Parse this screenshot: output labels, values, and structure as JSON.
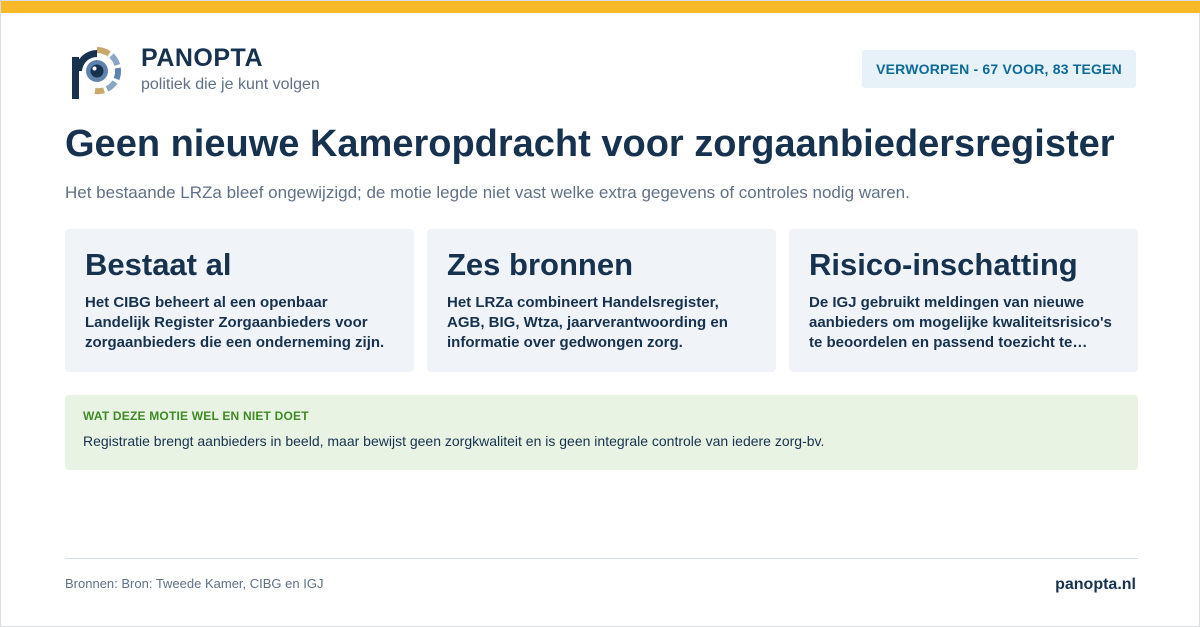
{
  "brand": {
    "name": "PANOPTA",
    "tagline": "politiek die je kunt volgen",
    "site": "panopta.nl"
  },
  "status_badge": "VERWORPEN - 67 VOOR, 83 TEGEN",
  "headline": "Geen nieuwe Kameropdracht voor zorgaanbiedersregister",
  "subheadline": "Het bestaande LRZa bleef ongewijzigd; de motie legde niet vast welke extra gegevens of controles nodig waren.",
  "cards": [
    {
      "title": "Bestaat al",
      "body": "Het CIBG beheert al een openbaar Landelijk Register Zorgaanbieders voor zorgaanbieders die een onderneming zijn."
    },
    {
      "title": "Zes bronnen",
      "body": "Het LRZa combineert Handelsregister, AGB, BIG, Wtza, jaarverantwoording en informatie over gedwongen zorg."
    },
    {
      "title": "Risico-inschatting",
      "body": "De IGJ gebruikt meldingen van nieuwe aanbieders om mogelijke kwaliteitsrisico's te beoordelen en passend toezicht te…"
    }
  ],
  "note": {
    "label": "WAT DEZE MOTIE WEL EN NIET DOET",
    "text": "Registratie brengt aanbieders in beeld, maar bewijst geen zorgkwaliteit en is geen integrale controle van iedere zorg-bv."
  },
  "footer": {
    "sources": "Bronnen: Bron: Tweede Kamer, CIBG en IGJ"
  },
  "colors": {
    "accent_bar": "#f7b928",
    "navy": "#16324f",
    "badge_text": "#0e6a97",
    "note_label": "#3f8a24"
  }
}
